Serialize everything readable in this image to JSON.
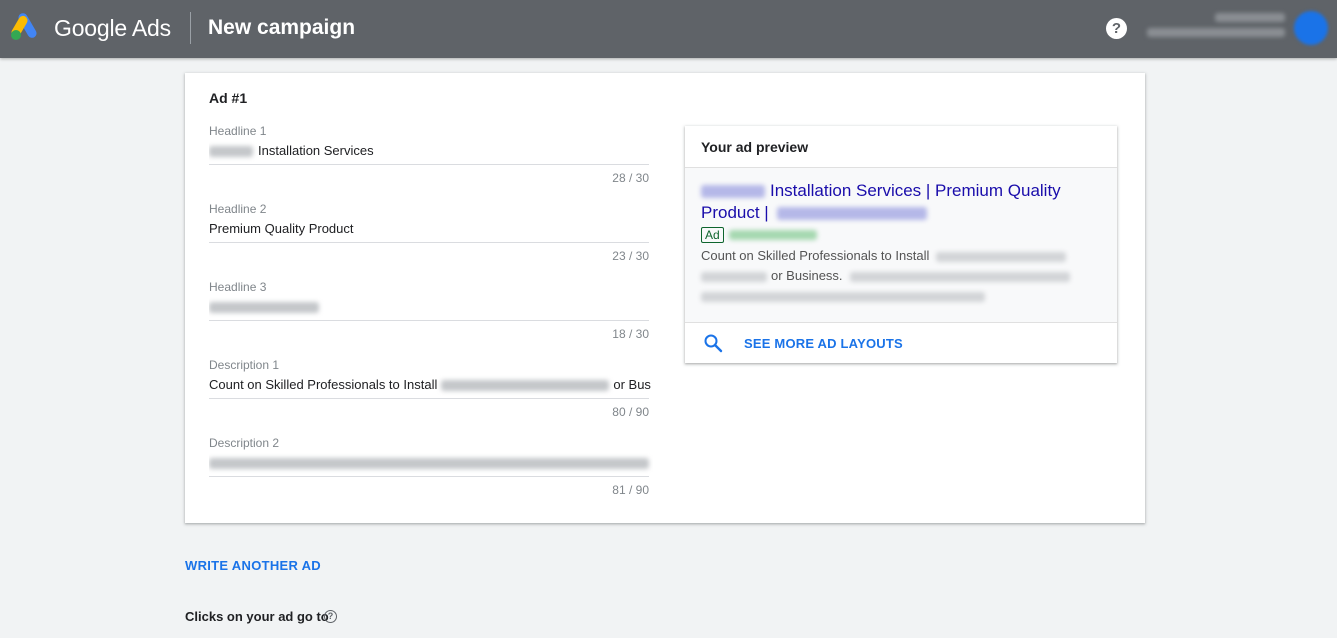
{
  "header": {
    "brand": "Google Ads",
    "page_title": "New campaign",
    "help_glyph": "?",
    "logo_icon": "google-ads-logo-icon",
    "colors": {
      "bar": "#5f6368",
      "logo_blue": "#4285f4",
      "logo_yellow": "#fbbc04",
      "logo_green": "#34a853"
    }
  },
  "ad": {
    "title": "Ad #1",
    "fields": [
      {
        "label": "Headline 1",
        "value": "Installation Services",
        "count": "28 / 30"
      },
      {
        "label": "Headline 2",
        "value": "Premium Quality Product",
        "count": "23 / 30"
      },
      {
        "label": "Headline 3",
        "value": "",
        "count": "18 / 30"
      },
      {
        "label": "Description 1",
        "value_start": "Count on Skilled Professionals to Install",
        "value_end": "or Bus",
        "count": "80 / 90"
      },
      {
        "label": "Description 2",
        "value": "",
        "count": "81 / 90"
      }
    ]
  },
  "preview": {
    "title": "Your ad preview",
    "headline_part1": "Installation Services | Premium Quality",
    "headline_part2": "Product |",
    "badge": "Ad",
    "desc_part1": "Count on Skilled Professionals to Install",
    "desc_part2": "or Business.",
    "more_label": "SEE MORE AD LAYOUTS",
    "more_icon": "search-icon",
    "colors": {
      "headline": "#1a0dab",
      "badge": "#0d652d",
      "link": "#1a73e8"
    }
  },
  "footer": {
    "write_another": "WRITE ANOTHER AD",
    "clicks_label": "Clicks on your ad go to",
    "clicks_help_glyph": "?"
  }
}
